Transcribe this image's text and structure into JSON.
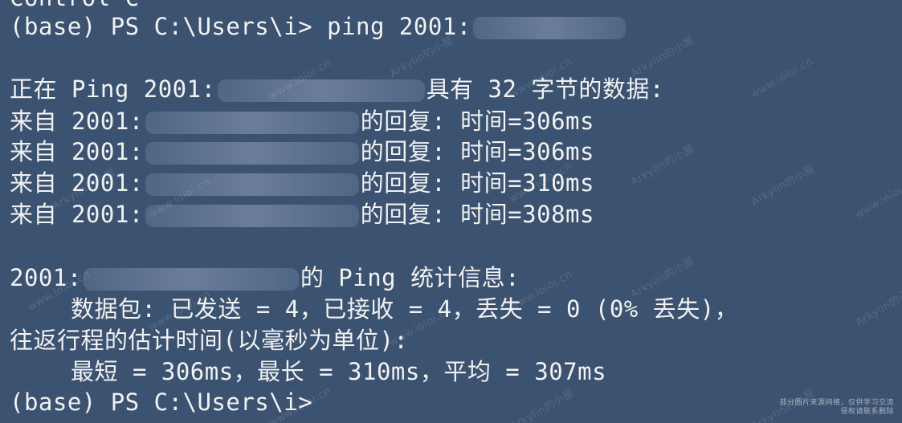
{
  "terminal": {
    "lines": {
      "l0": "Control-C",
      "l1": "(base) PS C:\\Users\\i> ping 2001:",
      "l3a": "正在 Ping 2001:",
      "l3b": "具有 32 字节的数据:",
      "l4a": "来自 2001:",
      "l4b": "的回复: 时间=306ms",
      "l5a": "来自 2001:",
      "l5b": "的回复: 时间=306ms",
      "l6a": "来自 2001:",
      "l6b": "的回复: 时间=310ms",
      "l7a": "来自 2001:",
      "l7b": "的回复: 时间=308ms",
      "l9a": "2001:",
      "l9b": "的 Ping 统计信息:",
      "l10": "数据包: 已发送 = 4，已接收 = 4，丢失 = 0 (0% 丢失)，",
      "l11": "往返行程的估计时间(以毫秒为单位):",
      "l12": "最短 = 306ms，最长 = 310ms，平均 = 307ms",
      "l13": "(base) PS C:\\Users\\i>"
    },
    "watermarks": [
      "Arkylin的小屋",
      "www.ioioi.cn"
    ],
    "corner_note": "部分图片来源网络，仅供学习交流\n侵权请联系删除"
  }
}
